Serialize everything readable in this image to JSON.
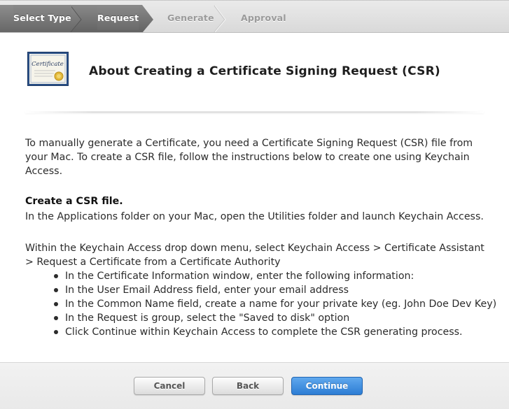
{
  "steps": {
    "items": [
      {
        "label": "Select Type",
        "state": "done"
      },
      {
        "label": "Request",
        "state": "done"
      },
      {
        "label": "Generate",
        "state": "todo"
      },
      {
        "label": "Approval",
        "state": "todo"
      }
    ]
  },
  "header": {
    "icon_text": "Certificate",
    "title": "About Creating a Certificate Signing Request (CSR)"
  },
  "content": {
    "intro": "To manually generate a Certificate, you need a Certificate Signing Request (CSR) file from your Mac. To create a CSR file, follow the instructions below to create one using Keychain Access.",
    "section_heading": "Create a CSR file.",
    "section_text": "In the Applications folder on your Mac, open the Utilities folder and launch Keychain Access.",
    "keychain_text": "Within the Keychain Access drop down menu, select Keychain Access > Certificate Assistant > Request a Certificate from a Certificate Authority",
    "bullets": [
      "In the Certificate Information window, enter the following information:",
      "In the User Email Address field, enter your email address",
      "In the Common Name field, create a name for your private key (eg. John Doe Dev Key)",
      "In the Request is group, select the \"Saved to disk\" option",
      "Click Continue within Keychain Access to complete the CSR generating process."
    ]
  },
  "footer": {
    "cancel_label": "Cancel",
    "back_label": "Back",
    "continue_label": "Continue"
  },
  "colors": {
    "step_done": "#7a7a7a",
    "step_todo": "#9a9a9a",
    "primary_button": "#2d7dd4"
  }
}
